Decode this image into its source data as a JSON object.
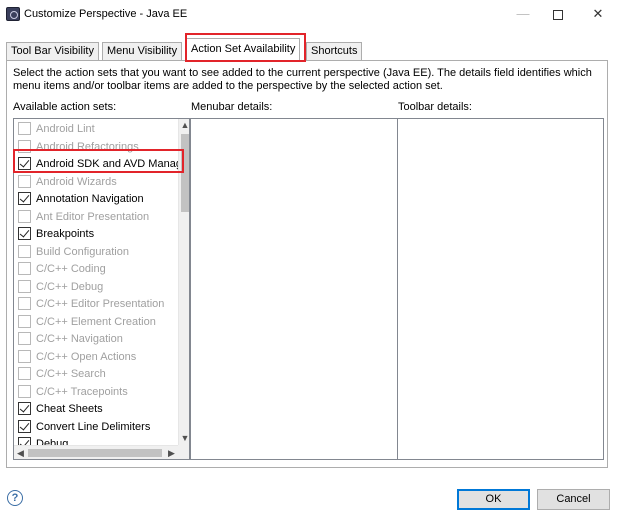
{
  "window": {
    "title": "Customize Perspective - Java EE",
    "minimize_glyph": "—",
    "close_glyph": "✕"
  },
  "tabs": [
    {
      "label": "Tool Bar Visibility",
      "active": false
    },
    {
      "label": "Menu Visibility",
      "active": false
    },
    {
      "label": "Action Set Availability",
      "active": true
    },
    {
      "label": "Shortcuts",
      "active": false
    }
  ],
  "description": "Select the action sets that you want to see added to the current perspective (Java EE).  The details field identifies which menu items and/or toolbar items are added to the perspective by the selected action set.",
  "columns": {
    "available": "Available action sets:",
    "menubar": "Menubar details:",
    "toolbar": "Toolbar details:"
  },
  "action_sets": [
    {
      "label": "Android Lint",
      "checked": false,
      "enabled": false
    },
    {
      "label": "Android Refactorings",
      "checked": false,
      "enabled": false
    },
    {
      "label": "Android SDK and AVD Manager",
      "checked": true,
      "enabled": true
    },
    {
      "label": "Android Wizards",
      "checked": false,
      "enabled": false
    },
    {
      "label": "Annotation Navigation",
      "checked": true,
      "enabled": true
    },
    {
      "label": "Ant Editor Presentation",
      "checked": false,
      "enabled": false
    },
    {
      "label": "Breakpoints",
      "checked": true,
      "enabled": true
    },
    {
      "label": "Build Configuration",
      "checked": false,
      "enabled": false
    },
    {
      "label": "C/C++ Coding",
      "checked": false,
      "enabled": false
    },
    {
      "label": "C/C++ Debug",
      "checked": false,
      "enabled": false
    },
    {
      "label": "C/C++ Editor Presentation",
      "checked": false,
      "enabled": false
    },
    {
      "label": "C/C++ Element Creation",
      "checked": false,
      "enabled": false
    },
    {
      "label": "C/C++ Navigation",
      "checked": false,
      "enabled": false
    },
    {
      "label": "C/C++ Open Actions",
      "checked": false,
      "enabled": false
    },
    {
      "label": "C/C++ Search",
      "checked": false,
      "enabled": false
    },
    {
      "label": "C/C++ Tracepoints",
      "checked": false,
      "enabled": false
    },
    {
      "label": "Cheat Sheets",
      "checked": true,
      "enabled": true
    },
    {
      "label": "Convert Line Delimiters",
      "checked": true,
      "enabled": true
    },
    {
      "label": "Debug",
      "checked": true,
      "enabled": true
    }
  ],
  "scroll_glyphs": {
    "up": "▲",
    "down": "▼",
    "left": "◀",
    "right": "▶"
  },
  "buttons": {
    "help": "?",
    "ok": "OK",
    "cancel": "Cancel"
  }
}
